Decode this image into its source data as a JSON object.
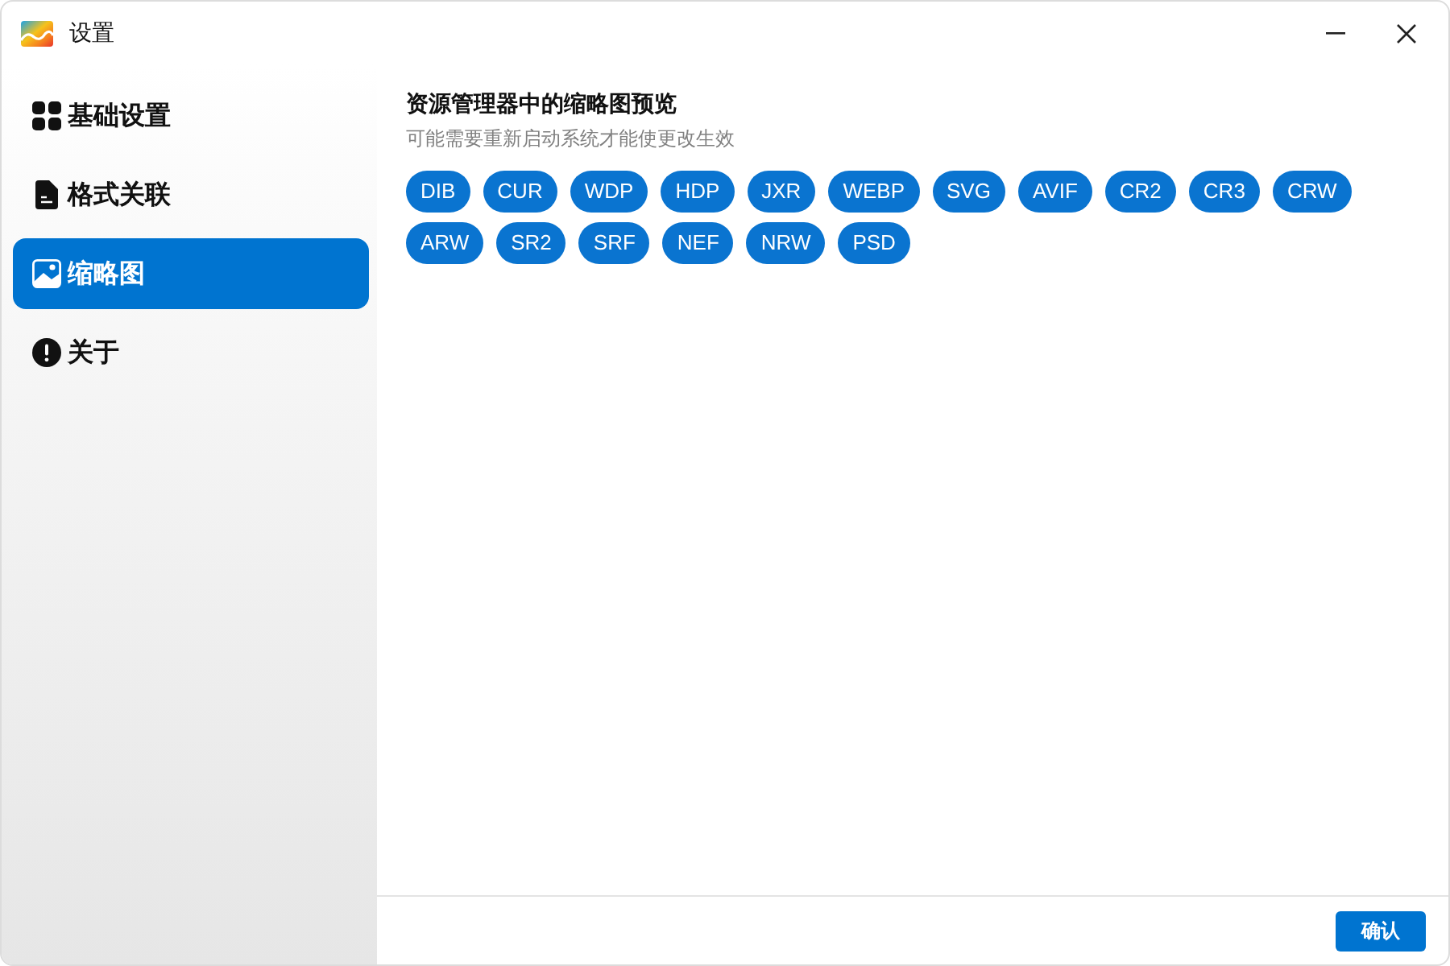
{
  "window": {
    "title": "设置"
  },
  "sidebar": {
    "items": [
      {
        "label": "基础设置",
        "kind": "grid",
        "selected": false
      },
      {
        "label": "格式关联",
        "kind": "document",
        "selected": false
      },
      {
        "label": "缩略图",
        "kind": "image",
        "selected": true
      },
      {
        "label": "关于",
        "kind": "info",
        "selected": false
      }
    ]
  },
  "content": {
    "title": "资源管理器中的缩略图预览",
    "subtitle": "可能需要重新启动系统才能使更改生效",
    "tags": [
      "DIB",
      "CUR",
      "WDP",
      "HDP",
      "JXR",
      "WEBP",
      "SVG",
      "AVIF",
      "CR2",
      "CR3",
      "CRW",
      "ARW",
      "SR2",
      "SRF",
      "NEF",
      "NRW",
      "PSD"
    ]
  },
  "footer": {
    "button": "确认"
  }
}
